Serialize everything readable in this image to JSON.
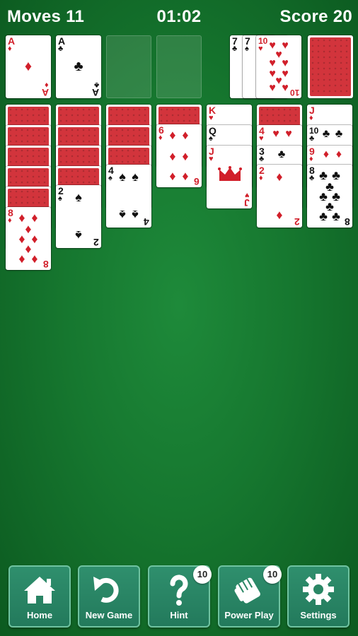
{
  "header": {
    "moves": "Moves 11",
    "time": "01:02",
    "score": "Score 20"
  },
  "foundations": [
    {
      "rank": "A",
      "suit": "♦",
      "color": "red"
    },
    {
      "rank": "A",
      "suit": "♣",
      "color": "black"
    }
  ],
  "waste": [
    {
      "rank": "7",
      "suit": "♣",
      "color": "black"
    },
    {
      "rank": "7",
      "suit": "♠",
      "color": "black"
    },
    {
      "rank": "10",
      "suit": "♥",
      "color": "red"
    }
  ],
  "tableau": {
    "col1": {
      "face_down": 5,
      "top": {
        "rank": "8",
        "suit": "♦",
        "color": "red"
      }
    },
    "col2": {
      "face_down": 4,
      "top": {
        "rank": "2",
        "suit": "♠",
        "color": "black"
      }
    },
    "col3": {
      "face_down": 3,
      "top": {
        "rank": "4",
        "suit": "♠",
        "color": "black"
      }
    },
    "col4": {
      "face_down": 1,
      "top": {
        "rank": "6",
        "suit": "♦",
        "color": "red"
      }
    },
    "col5": {
      "cards": [
        {
          "rank": "K",
          "suit": "♥",
          "color": "red"
        },
        {
          "rank": "Q",
          "suit": "♠",
          "color": "black"
        },
        {
          "rank": "J",
          "suit": "♥",
          "color": "red"
        }
      ]
    },
    "col6": {
      "face_down": 1,
      "cards": [
        {
          "rank": "4",
          "suit": "♥",
          "color": "red"
        },
        {
          "rank": "3",
          "suit": "♣",
          "color": "black"
        },
        {
          "rank": "2",
          "suit": "♦",
          "color": "red"
        }
      ]
    },
    "col7": {
      "cards": [
        {
          "rank": "J",
          "suit": "♦",
          "color": "red"
        },
        {
          "rank": "10",
          "suit": "♣",
          "color": "black"
        },
        {
          "rank": "9",
          "suit": "♦",
          "color": "red"
        },
        {
          "rank": "8",
          "suit": "♣",
          "color": "black"
        }
      ]
    }
  },
  "toolbar": {
    "home": "Home",
    "new_game": "New Game",
    "hint": "Hint",
    "hint_count": "10",
    "power_play": "Power Play",
    "power_play_count": "10",
    "settings": "Settings"
  },
  "colors": {
    "red": "#d11f2a",
    "card_back": "#d2343c",
    "felt": "#16772f",
    "button": "#2a8765"
  }
}
